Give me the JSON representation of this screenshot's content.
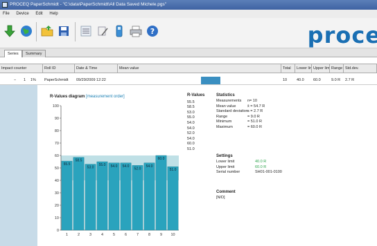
{
  "window": {
    "title": "PROCEQ PaperSchmidt - \"C:\\data\\PaperSchmidt\\All Data Saved Michele.pgs\""
  },
  "menu": [
    "File",
    "Device",
    "Edit",
    "Help"
  ],
  "toolbar": {
    "icons": [
      "download-arrow-icon",
      "globe-icon",
      "open-folder-icon",
      "save-icon",
      "list-icon",
      "wand-icon",
      "device-icon",
      "print-icon",
      "help-icon"
    ],
    "logo": "proce"
  },
  "tabs": [
    "Series",
    "Summary"
  ],
  "columns": [
    "Impact counter",
    "Roll ID",
    "Date & Time",
    "Mean value",
    "Total",
    "Lower limit",
    "Upper limit",
    "Range",
    "Std.dev."
  ],
  "row": {
    "expander": "−",
    "counter": "1",
    "pct": "1%",
    "roll_id": "PaperSchmidt",
    "datetime": "09/29/2009 12:22",
    "total": "10",
    "lower_limit": "40.0",
    "upper_limit": "60.0",
    "range": "9.0 R",
    "stddev": "2.7 R"
  },
  "diagram": {
    "title": "R-Values diagram",
    "subtitle": "[measurement order]"
  },
  "chart_data": {
    "type": "bar",
    "categories": [
      "1",
      "2",
      "3",
      "4",
      "5",
      "6",
      "7",
      "8",
      "9",
      "10"
    ],
    "values": [
      55.5,
      58.5,
      53.0,
      55.0,
      54.0,
      54.0,
      52.0,
      54.0,
      60.0,
      51.0
    ],
    "data_labels": [
      "55.5",
      "58.5",
      "53.0",
      "55.0",
      "54.0",
      "54.0",
      "52.0",
      "54.0",
      "60.0",
      "51.0"
    ],
    "ylim": [
      0,
      100
    ],
    "yticks": [
      0,
      10,
      20,
      30,
      40,
      50,
      60,
      70,
      80,
      90,
      100
    ],
    "band": [
      40,
      60
    ],
    "bar_color": "#2aa3bd",
    "band_color": "#bfe0e6"
  },
  "rvalues": {
    "title": "R-Values",
    "list": [
      "55.5",
      "58.5",
      "53.0",
      "55.0",
      "54.0",
      "54.0",
      "52.0",
      "54.0",
      "60.0",
      "51.0"
    ]
  },
  "statistics": {
    "title": "Statistics",
    "rows": [
      {
        "k": "Measurements",
        "v": "n= 10"
      },
      {
        "k": "Mean value",
        "v": "x̄ = 54.7 R"
      },
      {
        "k": "Standard deviation",
        "v": "s = 2.7 R"
      },
      {
        "k": "Range",
        "v": "= 9.0 R"
      },
      {
        "k": "Minimum",
        "v": "= 51.0 R"
      },
      {
        "k": "Maximum",
        "v": "= 60.0 R"
      }
    ]
  },
  "settings": {
    "title": "Settings",
    "rows": [
      {
        "k": "Lower limit",
        "v": "40.0 R"
      },
      {
        "k": "Upper limit",
        "v": "60.0 R"
      },
      {
        "k": "Serial number",
        "v": "SH01-001-0100"
      }
    ]
  },
  "comment": {
    "title": "Comment",
    "text": "[N/D]"
  }
}
